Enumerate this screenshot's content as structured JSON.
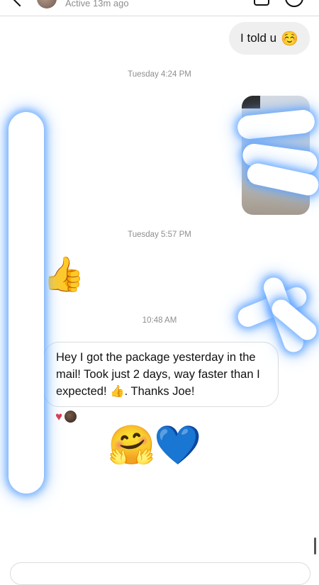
{
  "header": {
    "active_status": "Active 13m ago"
  },
  "messages": {
    "sent_text": "I told u",
    "sent_emoji": "☺️",
    "timestamp_1": "Tuesday 4:24 PM",
    "timestamp_2": "Tuesday 5:57 PM",
    "thumbs_emoji": "👍",
    "timestamp_3": "10:48 AM",
    "received_text": "Hey I got the package yesterday in the mail!  Took just 2 days, way faster than I expected!  👍. Thanks Joe!",
    "reaction_heart": "♥",
    "emoji_hug": "🤗",
    "emoji_blue_heart": "💙"
  },
  "colors": {
    "bubble_right_bg": "#efefef",
    "timestamp_text": "#8e8e8e",
    "reaction_heart": "#d93a4a",
    "redaction_glow": "#5aa0ff"
  }
}
